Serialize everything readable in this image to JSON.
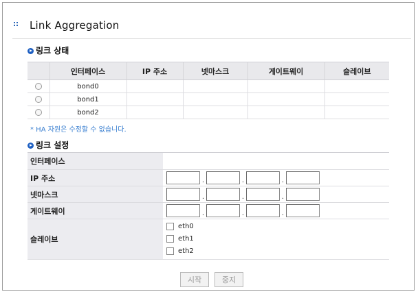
{
  "page": {
    "title": "Link Aggregation"
  },
  "link_status": {
    "heading": "링크 상태",
    "columns": [
      "",
      "인터페이스",
      "IP 주소",
      "넷마스크",
      "게이트웨이",
      "슬레이브"
    ],
    "rows": [
      {
        "name": "bond0"
      },
      {
        "name": "bond1"
      },
      {
        "name": "bond2"
      }
    ],
    "note": "* HA 자원은 수정할 수 없습니다."
  },
  "link_config": {
    "heading": "링크 설정",
    "interface_label": "인터페이스",
    "ip_label": "IP 주소",
    "netmask_label": "넷마스크",
    "gateway_label": "게이트웨이",
    "slave_label": "슬레이브",
    "slaves": [
      "eth0",
      "eth1",
      "eth2"
    ]
  },
  "buttons": {
    "start": "시작",
    "stop": "중지"
  }
}
